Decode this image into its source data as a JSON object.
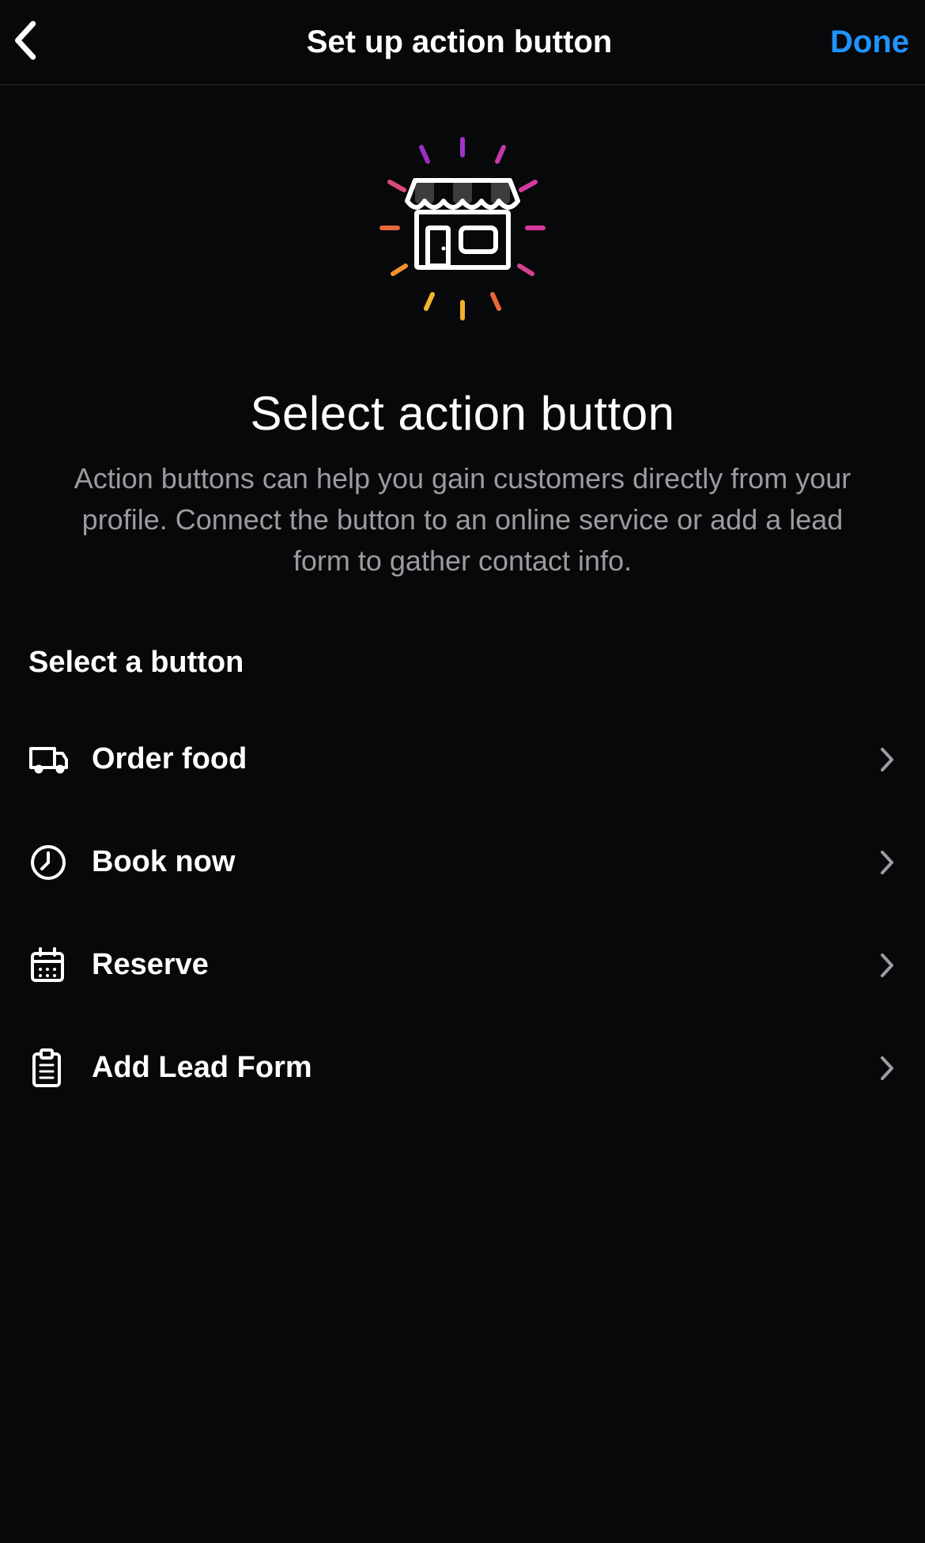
{
  "nav": {
    "title": "Set up action button",
    "done": "Done"
  },
  "hero": {
    "title": "Select action button",
    "subtitle": "Action buttons can help you gain customers directly from your profile. Connect the button to an online service or add a lead form to gather contact info."
  },
  "section_label": "Select a button",
  "options": [
    {
      "label": "Order food"
    },
    {
      "label": "Book now"
    },
    {
      "label": "Reserve"
    },
    {
      "label": "Add Lead Form"
    }
  ]
}
